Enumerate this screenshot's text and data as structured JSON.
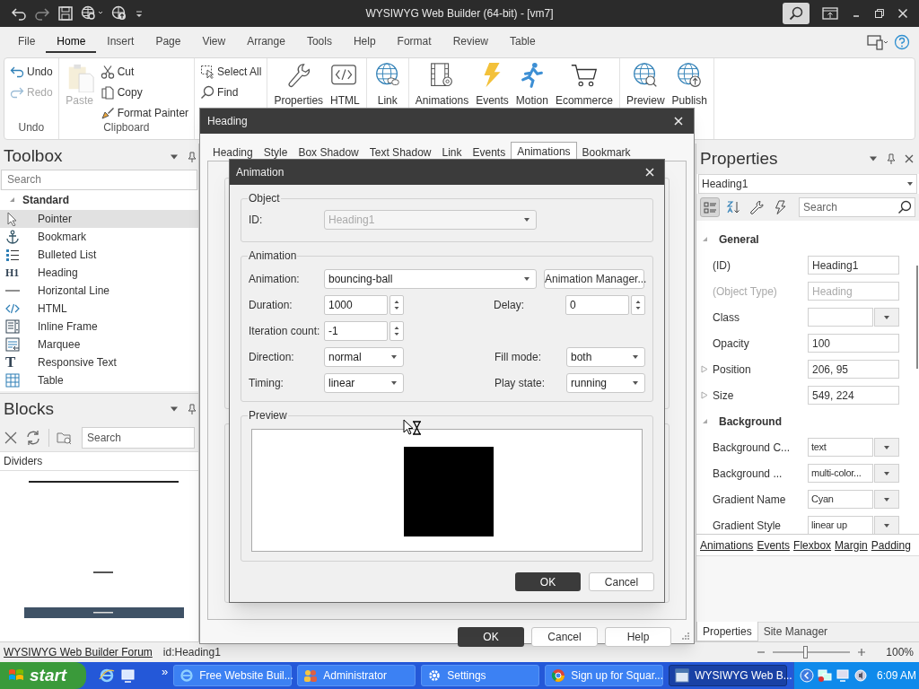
{
  "window": {
    "title": "WYSIWYG Web Builder (64-bit) - [vm7]"
  },
  "menu_tabs": [
    {
      "label": "File",
      "selected": false
    },
    {
      "label": "Home",
      "selected": true
    },
    {
      "label": "Insert",
      "selected": false
    },
    {
      "label": "Page",
      "selected": false
    },
    {
      "label": "View",
      "selected": false
    },
    {
      "label": "Arrange",
      "selected": false
    },
    {
      "label": "Tools",
      "selected": false
    },
    {
      "label": "Help",
      "selected": false
    },
    {
      "label": "Format",
      "selected": false
    },
    {
      "label": "Review",
      "selected": false
    },
    {
      "label": "Table",
      "selected": false
    }
  ],
  "ribbon": [
    {
      "label": "Undo",
      "items": [
        {
          "label": "Undo",
          "kind": "small",
          "disabled": false
        },
        {
          "label": "Redo",
          "kind": "small",
          "disabled": true
        }
      ]
    },
    {
      "label": "Clipboard",
      "items": [
        {
          "label": "Paste",
          "kind": "large",
          "disabled": true
        },
        {
          "label": "Cut",
          "kind": "small",
          "disabled": false
        },
        {
          "label": "Copy",
          "kind": "small",
          "disabled": false
        },
        {
          "label": "Format Painter",
          "kind": "small",
          "disabled": false
        }
      ]
    },
    {
      "items": [
        {
          "label": "Select All",
          "kind": "small",
          "disabled": false
        },
        {
          "label": "Find",
          "kind": "small",
          "disabled": false
        }
      ]
    },
    {
      "items": [
        {
          "label": "Properties",
          "kind": "large",
          "disabled": false
        },
        {
          "label": "HTML",
          "kind": "large",
          "disabled": false
        }
      ]
    },
    {
      "items": [
        {
          "label": "Link",
          "kind": "large",
          "disabled": false
        }
      ]
    },
    {
      "items": [
        {
          "label": "Animations",
          "kind": "large",
          "disabled": false
        },
        {
          "label": "Events",
          "kind": "large",
          "disabled": false
        },
        {
          "label": "Motion",
          "kind": "large",
          "disabled": false
        },
        {
          "label": "Ecommerce",
          "kind": "large",
          "disabled": false
        }
      ]
    },
    {
      "items": [
        {
          "label": "Preview",
          "kind": "large",
          "disabled": false
        },
        {
          "label": "Publish",
          "kind": "large",
          "disabled": false
        }
      ]
    }
  ],
  "toolbox": {
    "title": "Toolbox",
    "search_placeholder": "Search",
    "categories": [
      {
        "label": "Standard",
        "expanded": true,
        "items": [
          {
            "label": "Pointer",
            "selected": true
          },
          {
            "label": "Bookmark",
            "selected": false
          },
          {
            "label": "Bulleted List",
            "selected": false
          },
          {
            "label": "Heading",
            "selected": false,
            "glyph": "H1"
          },
          {
            "label": "Horizontal Line",
            "selected": false
          },
          {
            "label": "HTML",
            "selected": false
          },
          {
            "label": "Inline Frame",
            "selected": false
          },
          {
            "label": "Marquee",
            "selected": false
          },
          {
            "label": "Responsive Text",
            "selected": false,
            "glyph": "T"
          },
          {
            "label": "Table",
            "selected": false
          }
        ]
      }
    ]
  },
  "blocks": {
    "title": "Blocks",
    "search_placeholder": "Search",
    "category": "Dividers"
  },
  "properties": {
    "title": "Properties",
    "object": "Heading1",
    "search_placeholder": "Search",
    "view_buttons": [
      {
        "selected": true
      },
      {
        "selected": false
      },
      {
        "selected": false
      },
      {
        "selected": false
      }
    ],
    "sections": [
      {
        "label": "General",
        "expanded": true,
        "children": [
          {
            "label": "(ID)",
            "kind": "text",
            "value": "Heading1",
            "disabled": false
          },
          {
            "label": "(Object Type)",
            "kind": "text",
            "value": "Heading",
            "disabled": true
          },
          {
            "label": "Class",
            "kind": "combo",
            "disabled": false
          },
          {
            "label": "Opacity",
            "kind": "text",
            "value": "100",
            "disabled": false
          },
          {
            "label": "Position",
            "kind": "group",
            "value": "206, 95",
            "expanded": false,
            "disabled": false
          },
          {
            "label": "Size",
            "kind": "group",
            "value": "549, 224",
            "expanded": false,
            "disabled": false
          }
        ]
      },
      {
        "label": "Background",
        "expanded": true,
        "children": [
          {
            "label": "Background C...",
            "kind": "combo",
            "value": "text",
            "disabled": false
          },
          {
            "label": "Background ...",
            "kind": "combo",
            "value": "multi-color...",
            "disabled": false
          },
          {
            "label": "Gradient Name",
            "kind": "combo",
            "value": "Cyan",
            "disabled": false
          },
          {
            "label": "Gradient Style",
            "kind": "combo",
            "value": "linear up",
            "disabled": false
          }
        ]
      }
    ],
    "links": [
      "Animations",
      "Events",
      "Flexbox",
      "Margin",
      "Padding"
    ],
    "bottom_tabs": [
      {
        "label": "Properties",
        "selected": true
      },
      {
        "label": "Site Manager",
        "selected": false
      }
    ]
  },
  "heading_dialog": {
    "title": "Heading",
    "tabs": [
      {
        "label": "Heading",
        "selected": false
      },
      {
        "label": "Style",
        "selected": false
      },
      {
        "label": "Box Shadow",
        "selected": false
      },
      {
        "label": "Text Shadow",
        "selected": false
      },
      {
        "label": "Link",
        "selected": false
      },
      {
        "label": "Events",
        "selected": false
      },
      {
        "label": "Animations",
        "selected": true
      },
      {
        "label": "Bookmark",
        "selected": false
      }
    ],
    "buttons": [
      {
        "label": "OK",
        "default": true
      },
      {
        "label": "Cancel",
        "default": false
      },
      {
        "label": "Help",
        "default": false
      }
    ]
  },
  "animation_dialog": {
    "title": "Animation",
    "object_group": {
      "title": "Object",
      "label": "ID:",
      "value": "Heading1",
      "disabled": true
    },
    "animation_group": {
      "title": "Animation",
      "rows": [
        [
          {
            "label": "Animation:",
            "kind": "combo",
            "value": "bouncing-ball"
          },
          {
            "kind": "button",
            "label": "Animation Manager..."
          }
        ],
        [
          {
            "label": "Duration:",
            "kind": "spin",
            "value": "1000"
          },
          {
            "label": "Delay:",
            "kind": "spin",
            "value": "0"
          }
        ],
        [
          {
            "label": "Iteration count:",
            "kind": "spin",
            "value": "-1"
          }
        ],
        [
          {
            "label": "Direction:",
            "kind": "combo",
            "value": "normal"
          },
          {
            "label": "Fill mode:",
            "kind": "combo",
            "value": "both"
          }
        ],
        [
          {
            "label": "Timing:",
            "kind": "combo",
            "value": "linear"
          },
          {
            "label": "Play state:",
            "kind": "combo",
            "value": "running"
          }
        ]
      ]
    },
    "preview_group": {
      "title": "Preview"
    },
    "buttons": [
      {
        "label": "OK",
        "default": true
      },
      {
        "label": "Cancel",
        "default": false
      }
    ]
  },
  "status_bar": {
    "link": "WYSIWYG Web Builder Forum",
    "object_id": "id:Heading1",
    "zoom": {
      "level": 0.42,
      "reading": "100%"
    }
  },
  "taskbar": {
    "start": "start",
    "more": "»",
    "items": [
      {
        "label": "Free Website Buil...",
        "selected": false
      },
      {
        "label": "Administrator",
        "selected": false
      },
      {
        "label": "Settings",
        "selected": false
      },
      {
        "label": "Sign up for Squar...",
        "selected": false
      },
      {
        "label": "WYSIWYG Web B...",
        "selected": true
      }
    ],
    "clock": "6:09 AM"
  }
}
